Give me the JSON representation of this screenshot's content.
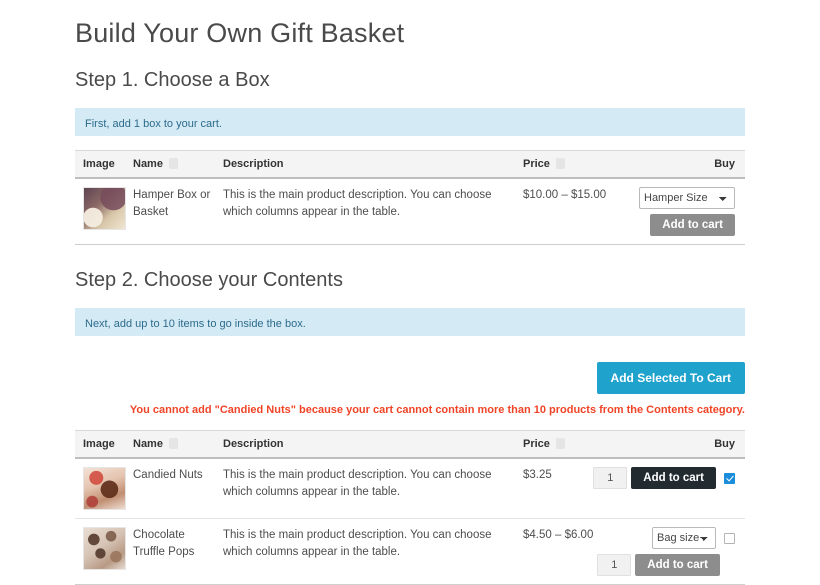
{
  "page": {
    "title": "Build Your Own Gift Basket"
  },
  "step1": {
    "heading": "Step 1. Choose a Box",
    "notice": "First, add 1 box to your cart.",
    "table": {
      "columns": [
        "Image",
        "Name",
        "Description",
        "Price",
        "Buy"
      ],
      "rows": [
        {
          "image_name": "hamper-box-thumbnail",
          "name": "Hamper Box or Basket",
          "description": "This is the main product description. You can choose which columns appear in the table.",
          "price": "$10.00 – $15.00",
          "variation_label": "Hamper Size",
          "add_label": "Add to cart"
        }
      ]
    }
  },
  "step2": {
    "heading": "Step 2. Choose your Contents",
    "notice": "Next, add up to 10 items to go inside the box.",
    "add_selected_label": "Add Selected To Cart",
    "error": "You cannot add \"Candied Nuts\" because your cart cannot contain more than 10 products from the Contents category.",
    "table": {
      "columns": [
        "Image",
        "Name",
        "Description",
        "Price",
        "Buy"
      ],
      "rows": [
        {
          "image_name": "candied-nuts-thumbnail",
          "name": "Candied Nuts",
          "description": "This is the main product description. You can choose which columns appear in the table.",
          "price": "$3.25",
          "quantity": "1",
          "add_label": "Add to cart",
          "selected": "checked"
        },
        {
          "image_name": "chocolate-truffle-pops-thumbnail",
          "name": "Chocolate Truffle Pops",
          "description": "This is the main product description. You can choose which columns appear in the table.",
          "price": "$4.50 – $6.00",
          "variation_label": "Bag size",
          "quantity": "1",
          "add_label": "Add to cart",
          "selected": "unchecked"
        }
      ]
    }
  },
  "colors": {
    "notice_bg": "#d4ebf5",
    "notice_text": "#2d6a8c",
    "accent_button": "#1fa2cc",
    "error_text": "#f04427",
    "dark_button": "#222b30",
    "grey_button": "#8d8d8d",
    "checkbox_checked": "#1b8ddb"
  }
}
